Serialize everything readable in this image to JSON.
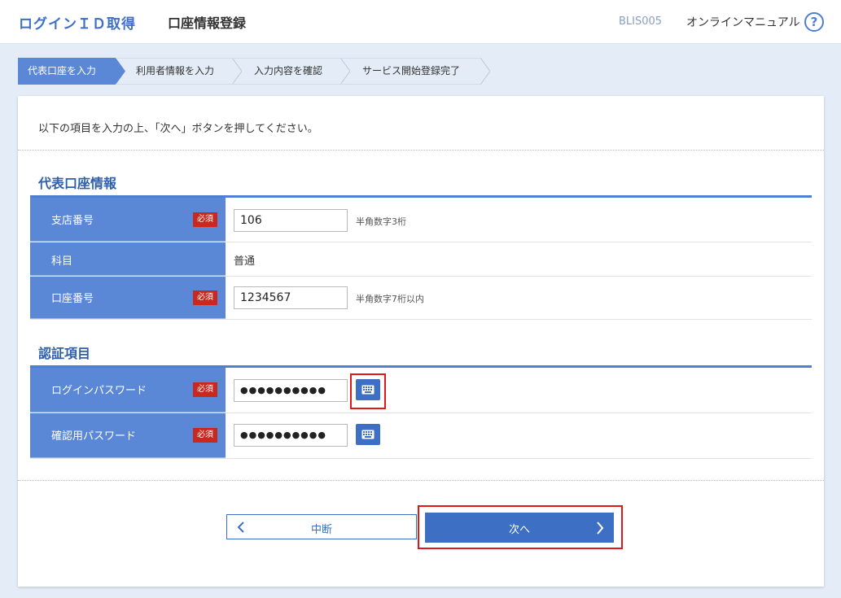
{
  "header": {
    "app_title": "ログインＩＤ取得",
    "page_title": "口座情報登録",
    "screen_id": "BLIS005",
    "manual_link": "オンラインマニュアル",
    "help_icon": "?"
  },
  "steps": [
    {
      "label": "代表口座を入力",
      "active": true
    },
    {
      "label": "利用者情報を入力",
      "active": false
    },
    {
      "label": "入力内容を確認",
      "active": false
    },
    {
      "label": "サービス開始登録完了",
      "active": false
    }
  ],
  "intro": "以下の項目を入力の上、「次へ」ボタンを押してください。",
  "account_section": {
    "title": "代表口座情報",
    "branch": {
      "label": "支店番号",
      "required": "必須",
      "value": "106",
      "hint": "半角数字3桁"
    },
    "subject": {
      "label": "科目",
      "value": "普通"
    },
    "account_number": {
      "label": "口座番号",
      "required": "必須",
      "value": "1234567",
      "hint": "半角数字7桁以内"
    }
  },
  "auth_section": {
    "title": "認証項目",
    "login_password": {
      "label": "ログインパスワード",
      "required": "必須",
      "value": "●●●●●●●●●●"
    },
    "confirm_password": {
      "label": "確認用パスワード",
      "required": "必須",
      "value": "●●●●●●●●●●"
    }
  },
  "buttons": {
    "cancel": "中断",
    "next": "次へ"
  },
  "colors": {
    "accent": "#3d6fc4",
    "label_bg": "#5b88d6",
    "required_badge": "#c8281e",
    "highlight": "#e01818"
  }
}
